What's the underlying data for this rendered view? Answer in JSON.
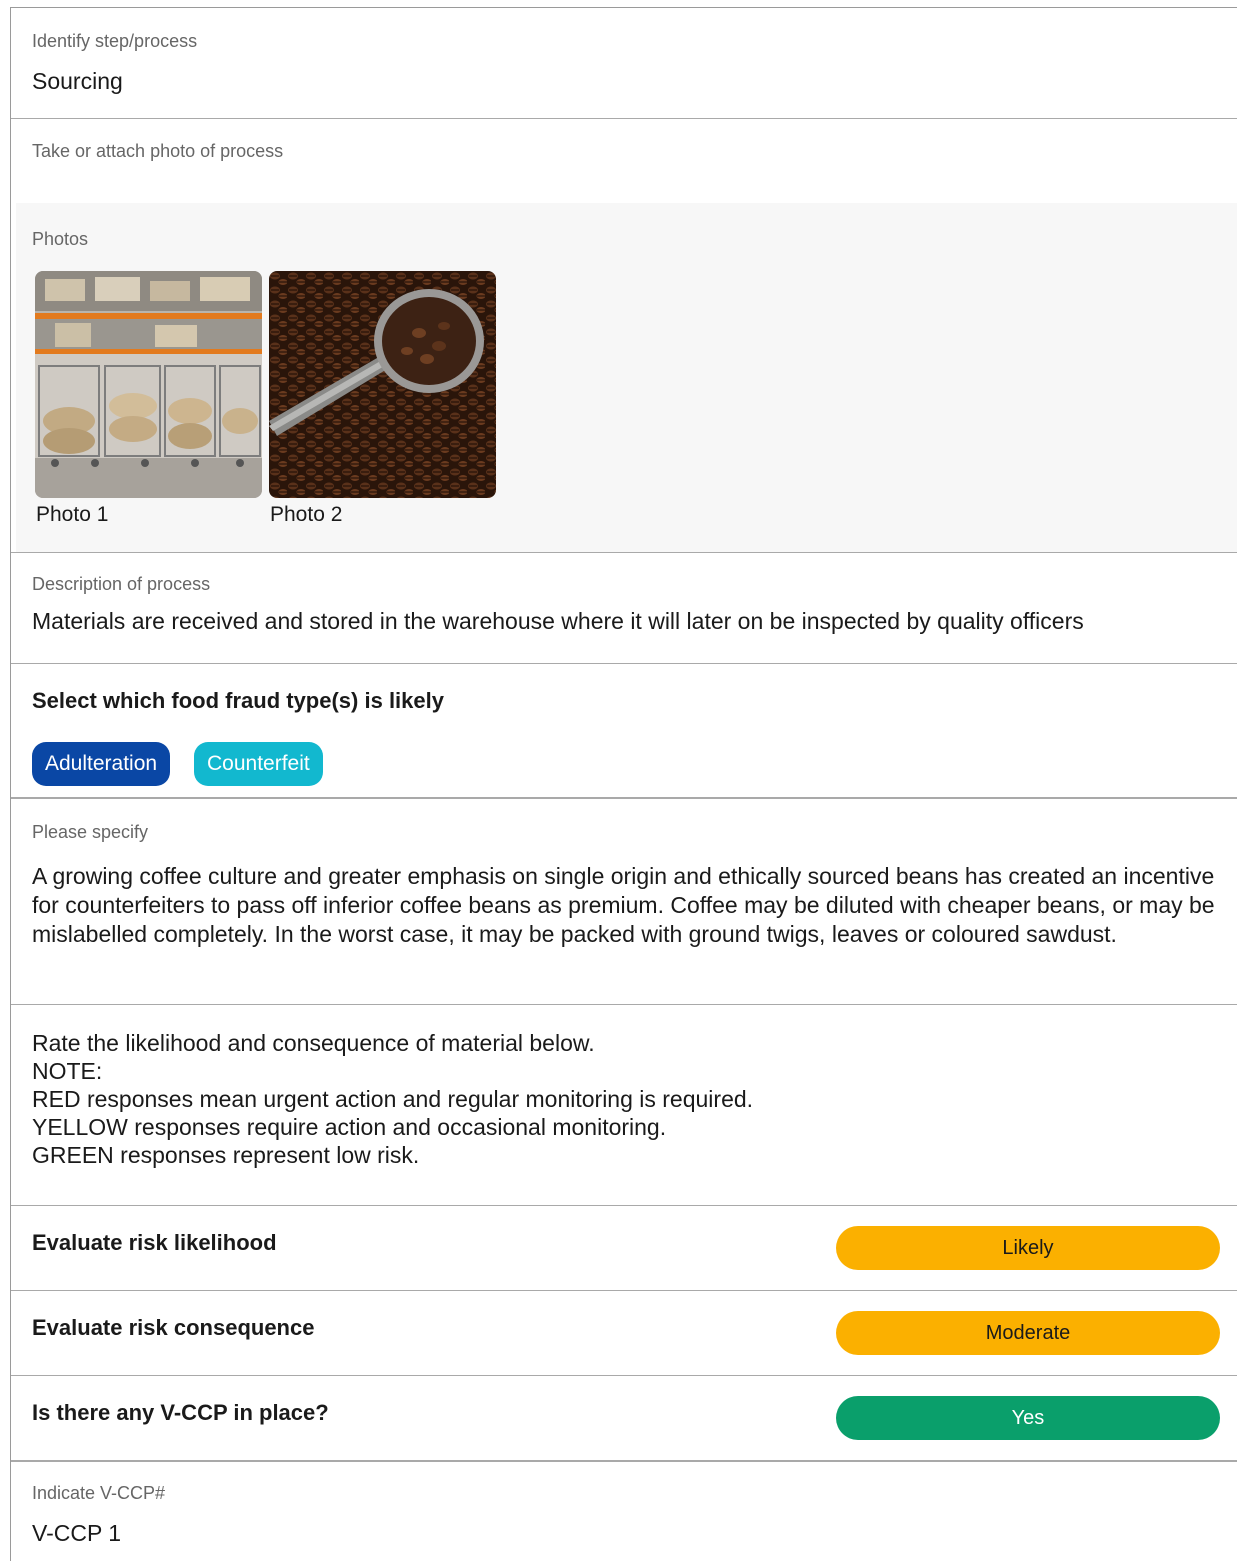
{
  "step": {
    "label": "Identify step/process",
    "value": "Sourcing"
  },
  "photo_field": {
    "label": "Take or attach photo of process"
  },
  "photos": {
    "label": "Photos",
    "items": [
      {
        "caption": "Photo 1",
        "subject": "warehouse sacks on shelves"
      },
      {
        "caption": "Photo 2",
        "subject": "coffee beans with metal scoop"
      }
    ]
  },
  "description": {
    "label": "Description of process",
    "value": "Materials are received and stored in the warehouse where it will later on be inspected by quality officers"
  },
  "fraud_types": {
    "label": "Select which food fraud type(s) is likely",
    "options": [
      {
        "label": "Adulteration",
        "color": "#0a47a5"
      },
      {
        "label": "Counterfeit",
        "color": "#12b8cf"
      }
    ]
  },
  "specify": {
    "label": "Please specify",
    "value": "A growing coffee culture and greater emphasis on single origin and ethically sourced beans has created an incentive for counterfeiters to pass off inferior coffee beans as premium. Coffee may be diluted with cheaper beans, or may be mislabelled completely. In the worst case, it may be packed with ground twigs, leaves or coloured sawdust."
  },
  "note": {
    "lines": [
      "Rate the likelihood and consequence of material below.",
      "NOTE:",
      "RED responses mean urgent action and regular monitoring is required.",
      "YELLOW responses require action and occasional monitoring.",
      "GREEN responses represent low risk."
    ]
  },
  "likelihood": {
    "label": "Evaluate risk likelihood",
    "answer": "Likely",
    "color": "#fbb000"
  },
  "consequence": {
    "label": "Evaluate risk consequence",
    "answer": "Moderate",
    "color": "#fbb000"
  },
  "vccp": {
    "label": "Is there any V-CCP in place?",
    "answer": "Yes",
    "color": "#0a9f6b"
  },
  "vccp_number": {
    "label": "Indicate V-CCP#",
    "value": "V-CCP 1"
  }
}
